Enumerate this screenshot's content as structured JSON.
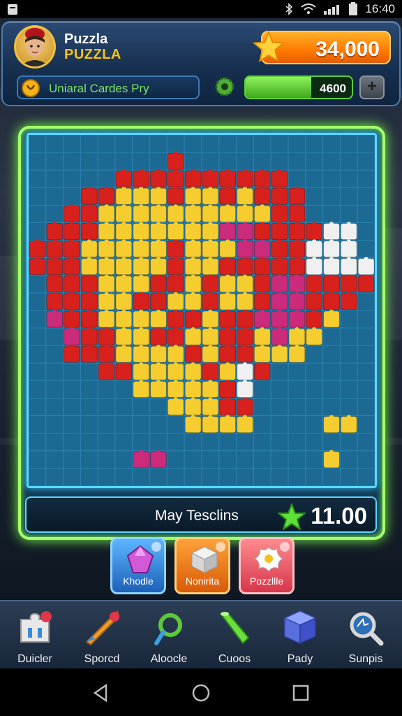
{
  "status_bar": {
    "time": "16:40"
  },
  "header": {
    "player_name": "Puzzla",
    "player_rank": "PUZZLA",
    "coins": "34,000",
    "mission_text": "Uniaral Cardes Pry",
    "energy_value": "4600",
    "energy_level": 0.62,
    "plus_label": "+"
  },
  "board": {
    "progress_label": "May Tesclins",
    "progress_value": "11.00"
  },
  "powerups": [
    {
      "label": "Khodle",
      "icon": "gem-icon",
      "color": "#2c8fe6"
    },
    {
      "label": "Nonirita",
      "icon": "cube-icon",
      "color": "#f07a12"
    },
    {
      "label": "Pozzllle",
      "icon": "splat-icon",
      "color": "#e84a5a"
    }
  ],
  "nav": [
    {
      "label": "Duicler",
      "icon": "puzzle-piece-icon"
    },
    {
      "label": "Sporcd",
      "icon": "rocket-icon"
    },
    {
      "label": "Aloocle",
      "icon": "magnet-icon"
    },
    {
      "label": "Cuoos",
      "icon": "tube-icon"
    },
    {
      "label": "Pady",
      "icon": "box-icon"
    },
    {
      "label": "Sunpis",
      "icon": "magnifier-icon"
    }
  ],
  "colors": {
    "red": "#d8201c",
    "yellow": "#f5cd2f",
    "magenta": "#cc2a7a",
    "white": "#f0f0f0",
    "board_blue": "#1c6a94"
  }
}
